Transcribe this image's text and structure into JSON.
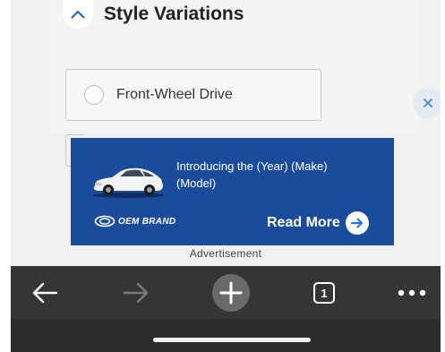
{
  "section": {
    "title": "Style Variations",
    "collapse_icon": "chevron-up-icon"
  },
  "option": {
    "label": "Front-Wheel Drive",
    "selected": false
  },
  "close_icon": "close-icon",
  "ad": {
    "headline": "Introducing the (Year) (Make) (Model)",
    "brand": "OEM BRAND",
    "cta": "Read More",
    "caption": "Advertisement",
    "colors": {
      "background": "#1b4b9b",
      "text": "#ffffff"
    }
  },
  "toolbar": {
    "back_icon": "back-arrow-icon",
    "forward_icon": "forward-arrow-icon",
    "new_tab_icon": "plus-icon",
    "tab_count": "1",
    "menu_icon": "more-icon",
    "colors": {
      "background": "#353535"
    }
  }
}
